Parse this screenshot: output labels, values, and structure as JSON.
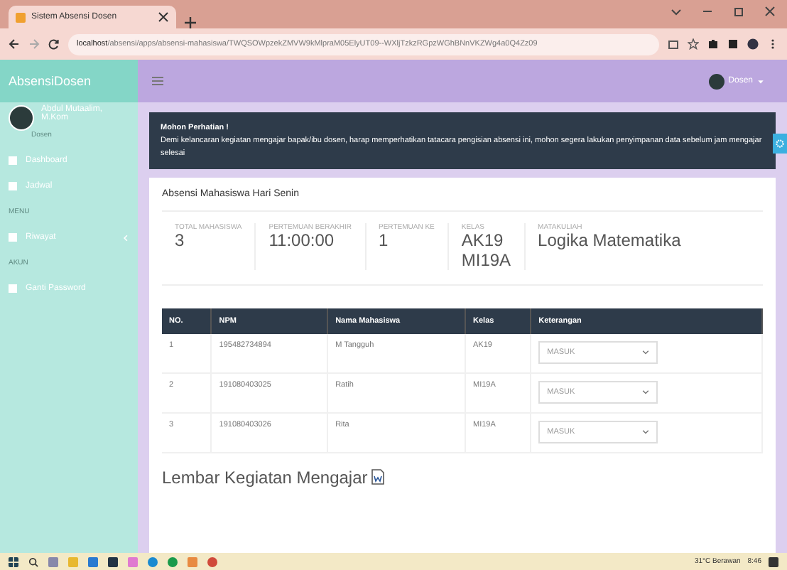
{
  "browser": {
    "tab_title": "Sistem Absensi Dosen",
    "url_host": "localhost",
    "url_path": "/absensi/apps/absensi-mahasiswa/TWQSOWpzekZMVW9kMlpraM05ElyUT09--WXljTzkzRGpzWGhBNnVKZWg4a0Q4Zz09"
  },
  "app": {
    "brand": "AbsensiDosen",
    "user_menu": "Dosen"
  },
  "sidebar": {
    "user_name": "Abdul Mutaalim, M.Kom",
    "user_role": "Dosen",
    "items": [
      {
        "kind": "link",
        "label": "Dashboard"
      },
      {
        "kind": "link",
        "label": "Jadwal"
      },
      {
        "kind": "header",
        "label": "MENU"
      },
      {
        "kind": "link",
        "label": "Riwayat",
        "expandable": true
      },
      {
        "kind": "header",
        "label": "AKUN"
      },
      {
        "kind": "link",
        "label": "Ganti Password"
      }
    ]
  },
  "alert": {
    "title": "Mohon Perhatian !",
    "message": "Demi kelancaran kegiatan mengajar bapak/ibu dosen, harap memperhatikan tatacara pengisian absensi ini, mohon segera lakukan penyimpanan data sebelum jam mengajar selesai"
  },
  "card": {
    "title": "Absensi Mahasiswa Hari Senin",
    "stats": [
      {
        "label": "TOTAL MAHASISWA",
        "value": "3"
      },
      {
        "label": "PERTEMUAN BERAKHIR",
        "value": "11:00:00"
      },
      {
        "label": "PERTEMUAN KE",
        "value": "1"
      },
      {
        "label": "KELAS",
        "value": "AK19 MI19A"
      },
      {
        "label": "MATAKULIAH",
        "value": "Logika Matematika"
      }
    ]
  },
  "table": {
    "columns": [
      "NO.",
      "NPM",
      "Nama Mahasiswa",
      "Kelas",
      "Keterangan"
    ],
    "rows": [
      {
        "no": "1",
        "npm": "195482734894",
        "name": "M Tangguh",
        "kelas": "AK19",
        "keterangan": "MASUK"
      },
      {
        "no": "2",
        "npm": "191080403025",
        "name": "Ratih",
        "kelas": "MI19A",
        "keterangan": "MASUK"
      },
      {
        "no": "3",
        "npm": "191080403026",
        "name": "Rita",
        "kelas": "MI19A",
        "keterangan": "MASUK"
      }
    ]
  },
  "section_title": "Lembar Kegiatan Mengajar",
  "taskbar": {
    "weather": "31°C Berawan",
    "time": "8:46"
  }
}
